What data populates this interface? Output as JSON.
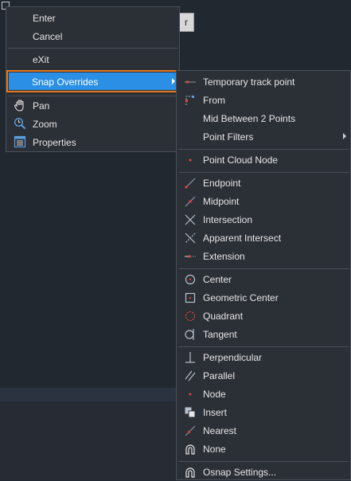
{
  "background": {
    "button_text": "r"
  },
  "context_menu": {
    "items": [
      {
        "label": "Enter"
      },
      {
        "label": "Cancel"
      },
      {
        "label": "eXit"
      },
      {
        "label": "Snap Overrides"
      },
      {
        "label": "Pan"
      },
      {
        "label": "Zoom"
      },
      {
        "label": "Properties"
      }
    ]
  },
  "submenu": {
    "items": [
      {
        "label": "Temporary track point"
      },
      {
        "label": "From"
      },
      {
        "label": "Mid Between 2 Points"
      },
      {
        "label": "Point Filters"
      },
      {
        "label": "Point Cloud Node"
      },
      {
        "label": "Endpoint"
      },
      {
        "label": "Midpoint"
      },
      {
        "label": "Intersection"
      },
      {
        "label": "Apparent Intersect"
      },
      {
        "label": "Extension"
      },
      {
        "label": "Center"
      },
      {
        "label": "Geometric Center"
      },
      {
        "label": "Quadrant"
      },
      {
        "label": "Tangent"
      },
      {
        "label": "Perpendicular"
      },
      {
        "label": "Parallel"
      },
      {
        "label": "Node"
      },
      {
        "label": "Insert"
      },
      {
        "label": "Nearest"
      },
      {
        "label": "None"
      },
      {
        "label": "Osnap Settings..."
      }
    ]
  },
  "colors": {
    "highlight": "#2b8fe5",
    "focus_border": "#e6781e",
    "snap_red": "#e0443c"
  }
}
